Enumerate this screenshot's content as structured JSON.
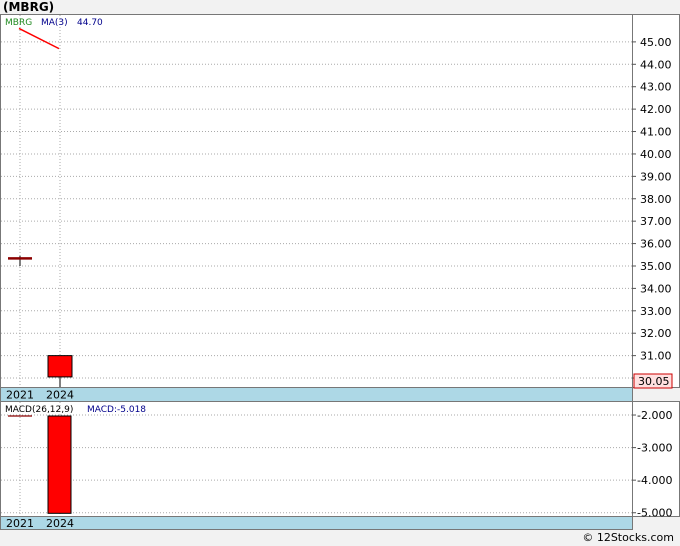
{
  "title": "(MBRG)",
  "credit": "© 12Stocks.com",
  "colors": {
    "up_candle": "#ff0000",
    "ma_line": "#ff0000",
    "macd_bar": "#ff0000",
    "macd_line": "#8b0000",
    "legend_symbol": "#228b22",
    "legend_value": "#00008b",
    "axis_band": "#add8e6",
    "price_marker": "#ffe0e0"
  },
  "price_legend": {
    "symbol": "MBRG",
    "ma_label": "MA(3)",
    "ma_value": "44.70"
  },
  "macd_legend": {
    "label": "MACD(26,12,9)",
    "value_text": "MACD:-5.018"
  },
  "last_price_label": "30.05",
  "chart_data": [
    {
      "type": "candlestick",
      "title": "(MBRG)",
      "x": [
        "2021",
        "2024"
      ],
      "ylim": [
        29.6,
        46.2
      ],
      "yticks": [
        "30.00",
        "31.00",
        "32.00",
        "33.00",
        "34.00",
        "35.00",
        "36.00",
        "37.00",
        "38.00",
        "39.00",
        "40.00",
        "41.00",
        "42.00",
        "43.00",
        "44.00",
        "45.00"
      ],
      "grid": true,
      "candles": [
        {
          "x": "2021",
          "open": 35.35,
          "close": 35.35,
          "high": 35.45,
          "low": 35.0
        },
        {
          "x": "2024",
          "open": 30.05,
          "close": 31.0,
          "high": 31.0,
          "low": 29.6
        }
      ],
      "ma": {
        "name": "MA(3)",
        "points": [
          {
            "x": "2021",
            "y": 45.6
          },
          {
            "x": "2024",
            "y": 44.7
          }
        ]
      },
      "last_price": 30.05
    },
    {
      "type": "bar",
      "title": "MACD(26,12,9)",
      "categories": [
        "2021",
        "2024"
      ],
      "ylim": [
        -5.1,
        -1.6
      ],
      "yticks": [
        "-2.000",
        "-3.000",
        "-4.000",
        "-5.000"
      ],
      "grid": true,
      "bars": [
        {
          "x": "2024",
          "value": -5.018
        }
      ],
      "macd_line": [
        {
          "x": "2021",
          "value": -1.6
        }
      ]
    }
  ]
}
